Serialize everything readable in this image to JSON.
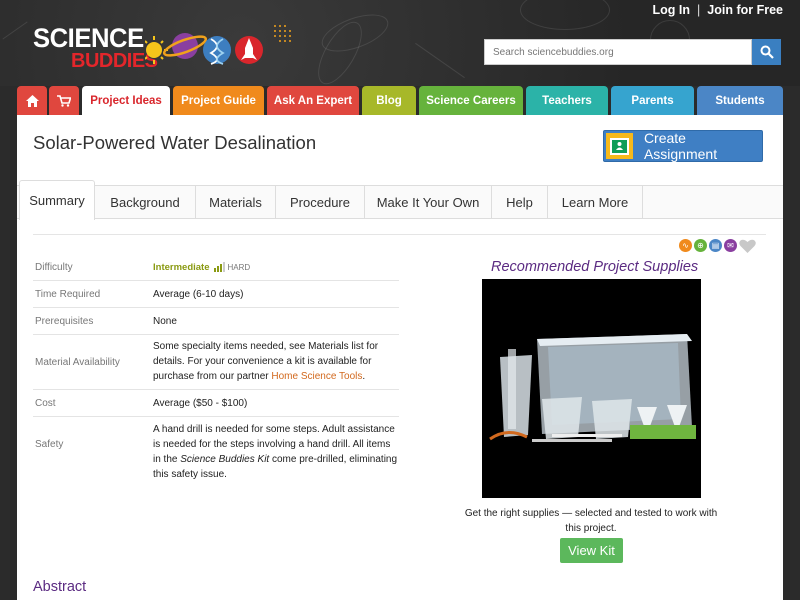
{
  "header": {
    "login": "Log In",
    "separator": "|",
    "join": "Join for Free",
    "logo_line1": "SCIENCE",
    "logo_line2": "BUDDIES",
    "search_placeholder": "Search sciencebuddies.org"
  },
  "nav": {
    "items": [
      {
        "label": "",
        "icon": "home-icon",
        "color": "#e0473e"
      },
      {
        "label": "",
        "icon": "cart-icon",
        "color": "#e0473e"
      },
      {
        "label": "Project Ideas",
        "color": "#d9262c"
      },
      {
        "label": "Project Guide",
        "color": "#f08a1c"
      },
      {
        "label": "Ask An Expert",
        "color": "#e0473e"
      },
      {
        "label": "Blog",
        "color": "#a7b829"
      },
      {
        "label": "Science Careers",
        "color": "#66b33c"
      },
      {
        "label": "Teachers",
        "color": "#2bb3a8"
      },
      {
        "label": "Parents",
        "color": "#36a4cf"
      },
      {
        "label": "Students",
        "color": "#4b86c6"
      }
    ]
  },
  "page": {
    "title": "Solar-Powered Water Desalination",
    "create_assignment": "Create Assignment"
  },
  "tabs": [
    "Summary",
    "Background",
    "Materials",
    "Procedure",
    "Make It Your Own",
    "Help",
    "Learn More"
  ],
  "info": {
    "difficulty_label": "Difficulty",
    "difficulty_value": "Intermediate",
    "difficulty_hard": "HARD",
    "time_label": "Time Required",
    "time_value": "Average (6-10 days)",
    "prereq_label": "Prerequisites",
    "prereq_value": "None",
    "material_label": "Material Availability",
    "material_value_pre": "Some specialty items needed, see Materials list for details. For your convenience a kit is available for purchase from our partner ",
    "material_link": "Home Science Tools",
    "material_value_post": ".",
    "cost_label": "Cost",
    "cost_value": "Average ($50 - $100)",
    "safety_label": "Safety",
    "safety_pre": "A hand drill is needed for some steps. Adult assistance is needed for the steps involving a hand drill. All items in the ",
    "safety_italic": "Science Buddies Kit",
    "safety_post": " come pre-drilled, eliminating this safety issue."
  },
  "supplies": {
    "title": "Recommended Project Supplies",
    "caption": "Get the right supplies — selected and tested to work with this project.",
    "button": "View Kit"
  },
  "abstract_heading": "Abstract"
}
